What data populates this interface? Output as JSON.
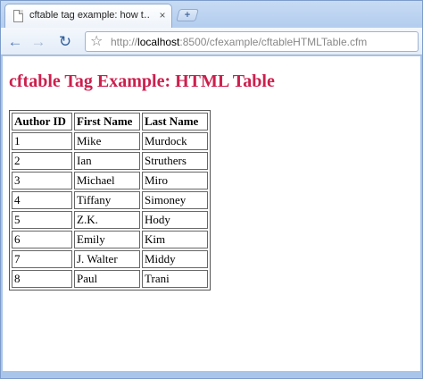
{
  "browser": {
    "tab_title": "cftable tag example: how t…",
    "tab_close": "×",
    "new_tab": "+",
    "url_prefix": "http://",
    "url_host": "localhost",
    "url_rest": ":8500/cfexample/cftableHTMLTable.cfm"
  },
  "page": {
    "title": "cftable Tag Example: HTML Table",
    "title_color": "#cc1f4e",
    "table": {
      "headers": [
        "Author ID",
        "First Name",
        "Last Name"
      ],
      "rows": [
        [
          "1",
          "Mike",
          "Murdock"
        ],
        [
          "2",
          "Ian",
          "Struthers"
        ],
        [
          "3",
          "Michael",
          "Miro"
        ],
        [
          "4",
          "Tiffany",
          "Simoney"
        ],
        [
          "5",
          "Z.K.",
          "Hody"
        ],
        [
          "6",
          "Emily",
          "Kim"
        ],
        [
          "7",
          "J. Walter",
          "Middy"
        ],
        [
          "8",
          "Paul",
          "Trani"
        ]
      ]
    }
  }
}
